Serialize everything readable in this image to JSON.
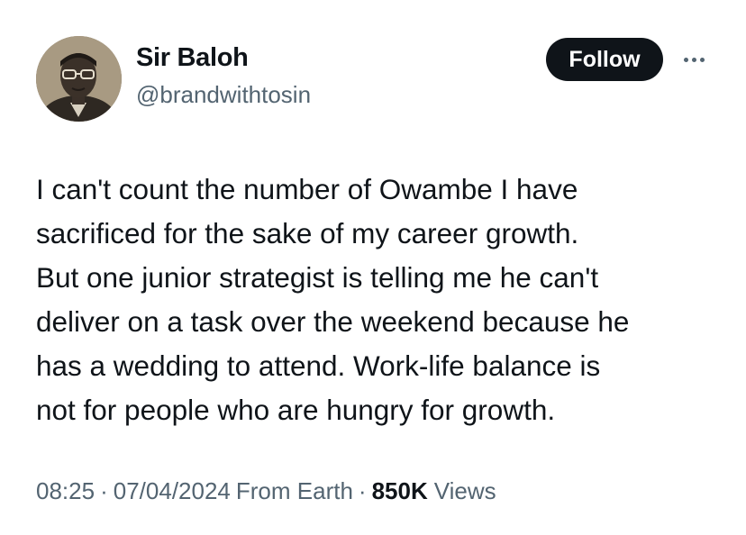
{
  "author": {
    "display_name": "Sir Baloh",
    "handle": "@brandwithtosin",
    "avatar_icon": "profile-photo"
  },
  "actions": {
    "follow_label": "Follow",
    "more_icon": "ellipsis-icon"
  },
  "tweet": {
    "text": "I can't count the number of Owambe I have\nsacrificed for the sake of my career growth.\nBut one junior strategist is telling me he can't\ndeliver on a task over the weekend because he\nhas a wedding to attend. Work-life balance is\nnot for people who are hungry for growth."
  },
  "meta": {
    "time": "08:25",
    "separator": "·",
    "date": "07/04/2024",
    "source": "From Earth",
    "views_count": "850K",
    "views_label": "Views"
  },
  "colors": {
    "text_primary": "#0f1419",
    "text_secondary": "#536471",
    "button_bg": "#0f1419",
    "background": "#ffffff"
  }
}
